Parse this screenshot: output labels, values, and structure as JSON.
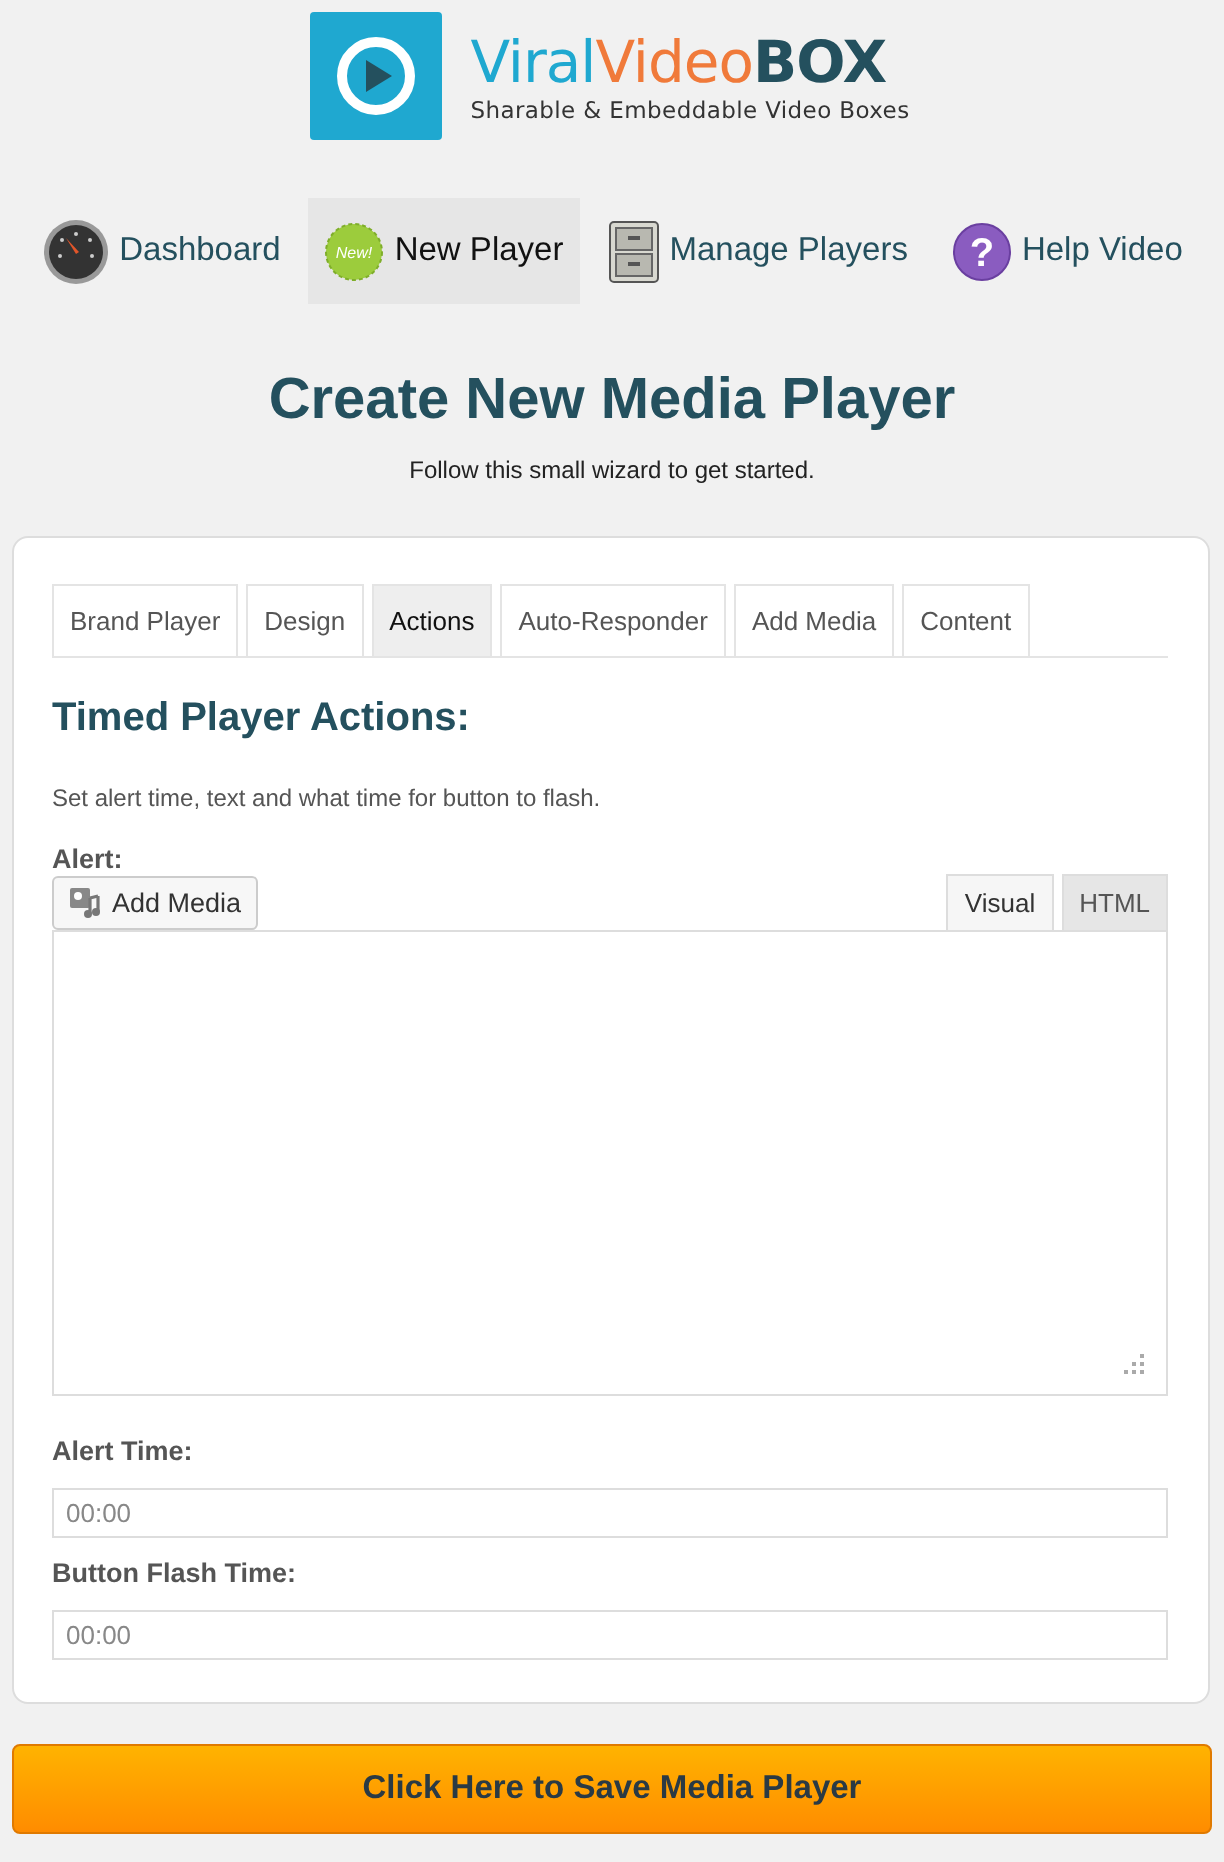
{
  "logo": {
    "parts": [
      {
        "text": "Viral",
        "color": "#1fa8d0"
      },
      {
        "text": "Video",
        "color": "#f07a3a"
      },
      {
        "text": "BOX",
        "color": "#24505e"
      }
    ],
    "tagline": "Sharable & Embeddable Video Boxes"
  },
  "nav": [
    {
      "kind": "dashboard",
      "label": "Dashboard",
      "selected": false
    },
    {
      "kind": "new",
      "label": "New Player",
      "badge": "New!",
      "selected": true
    },
    {
      "kind": "manage",
      "label": "Manage Players",
      "selected": false
    },
    {
      "kind": "help",
      "label": "Help Video",
      "badge": "?",
      "selected": false
    }
  ],
  "heading": "Create New Media Player",
  "subheading": "Follow this small wizard to get started.",
  "tabs": [
    {
      "label": "Brand Player",
      "selected": false
    },
    {
      "label": "Design",
      "selected": false
    },
    {
      "label": "Actions",
      "selected": true
    },
    {
      "label": "Auto-Responder",
      "selected": false
    },
    {
      "label": "Add Media",
      "selected": false
    },
    {
      "label": "Content",
      "selected": false
    }
  ],
  "section": {
    "title": "Timed Player Actions:",
    "description": "Set alert time, text and what time for button to flash."
  },
  "alert": {
    "label": "Alert:",
    "add_media": "Add Media",
    "editor_tabs": [
      {
        "label": "Visual",
        "selected": true
      },
      {
        "label": "HTML",
        "selected": false
      }
    ]
  },
  "fields": [
    {
      "label": "Alert Time:",
      "placeholder": "00:00"
    },
    {
      "label": "Button Flash Time:",
      "placeholder": "00:00"
    }
  ],
  "save_button": "Click Here to Save Media Player"
}
